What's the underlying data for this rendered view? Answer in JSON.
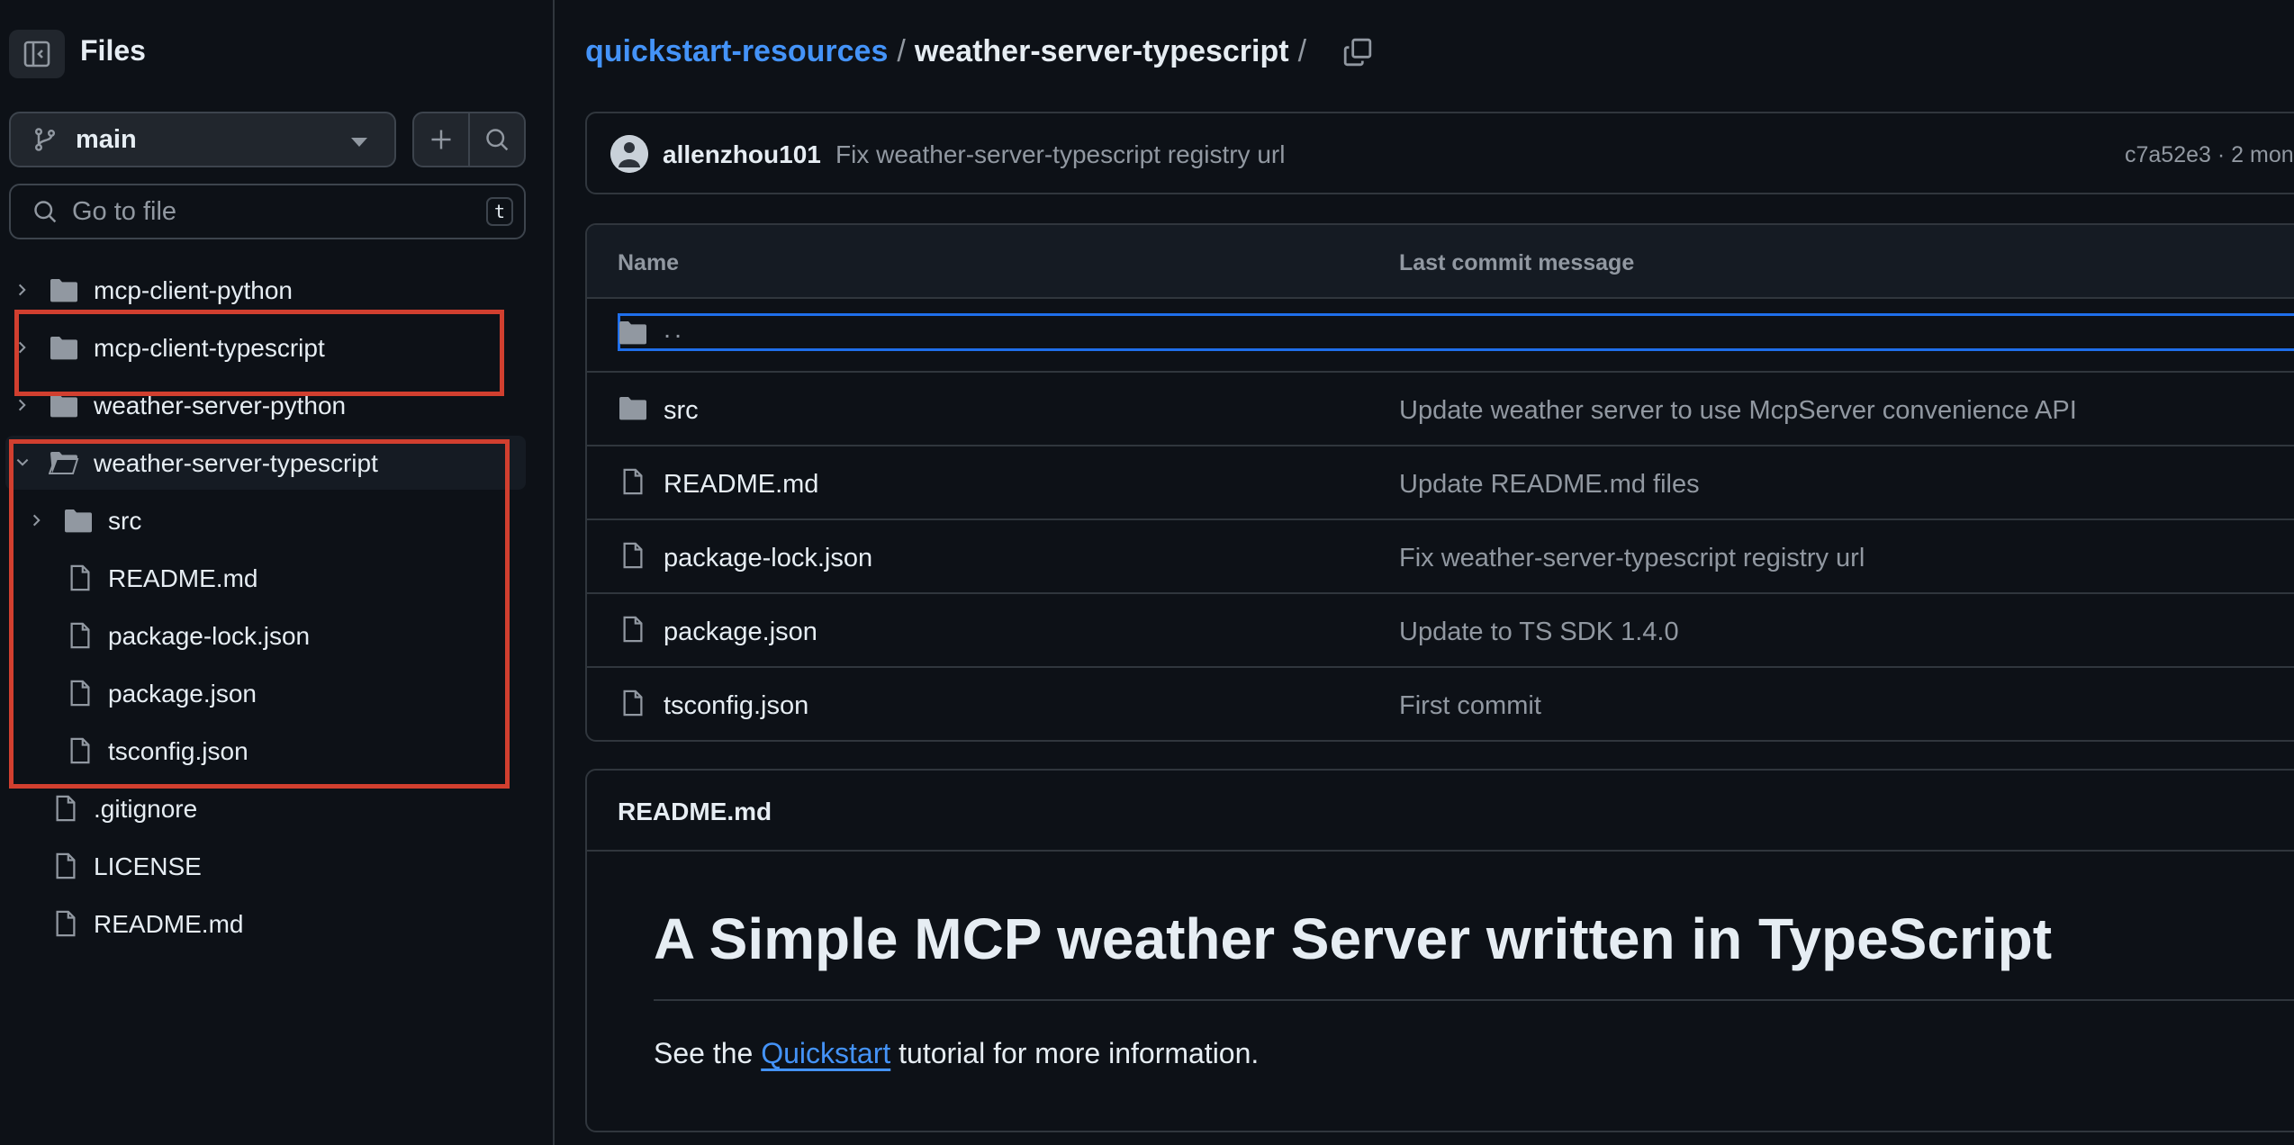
{
  "sidebar": {
    "title": "Files",
    "branch": "main",
    "goto_placeholder": "Go to file",
    "goto_shortcut": "t",
    "tree": [
      {
        "label": "mcp-client-python",
        "type": "folder",
        "expanded": false
      },
      {
        "label": "mcp-client-typescript",
        "type": "folder",
        "expanded": false
      },
      {
        "label": "weather-server-python",
        "type": "folder",
        "expanded": false
      },
      {
        "label": "weather-server-typescript",
        "type": "folder",
        "expanded": true
      },
      {
        "label": "src",
        "type": "folder",
        "expanded": false
      },
      {
        "label": "README.md",
        "type": "file"
      },
      {
        "label": "package-lock.json",
        "type": "file"
      },
      {
        "label": "package.json",
        "type": "file"
      },
      {
        "label": "tsconfig.json",
        "type": "file"
      },
      {
        "label": ".gitignore",
        "type": "file"
      },
      {
        "label": "LICENSE",
        "type": "file"
      },
      {
        "label": "README.md",
        "type": "file"
      }
    ]
  },
  "breadcrumb": {
    "repo": "quickstart-resources",
    "separator": "/",
    "current": "weather-server-typescript",
    "trailing": "/"
  },
  "commit": {
    "author": "allenzhou101",
    "message": "Fix weather-server-typescript registry url",
    "meta": "c7a52e3 · 2 mon"
  },
  "table": {
    "col_name": "Name",
    "col_message": "Last commit message",
    "parent": "..",
    "rows": [
      {
        "name": "src",
        "type": "folder",
        "message": "Update weather server to use McpServer convenience API"
      },
      {
        "name": "README.md",
        "type": "file",
        "message": "Update README.md files"
      },
      {
        "name": "package-lock.json",
        "type": "file",
        "message": "Fix weather-server-typescript registry url"
      },
      {
        "name": "package.json",
        "type": "file",
        "message": "Update to TS SDK 1.4.0"
      },
      {
        "name": "tsconfig.json",
        "type": "file",
        "message": "First commit"
      }
    ]
  },
  "readme": {
    "header": "README.md",
    "heading": "A Simple MCP weather Server written in TypeScript",
    "para_before": "See the ",
    "para_link": "Quickstart",
    "para_after": " tutorial for more information."
  },
  "colors": {
    "background": "#0d1117",
    "border": "#30363d",
    "link": "#4493f8",
    "muted": "#9198a1",
    "annotation": "#d13f2f",
    "selection": "#1f6feb"
  }
}
